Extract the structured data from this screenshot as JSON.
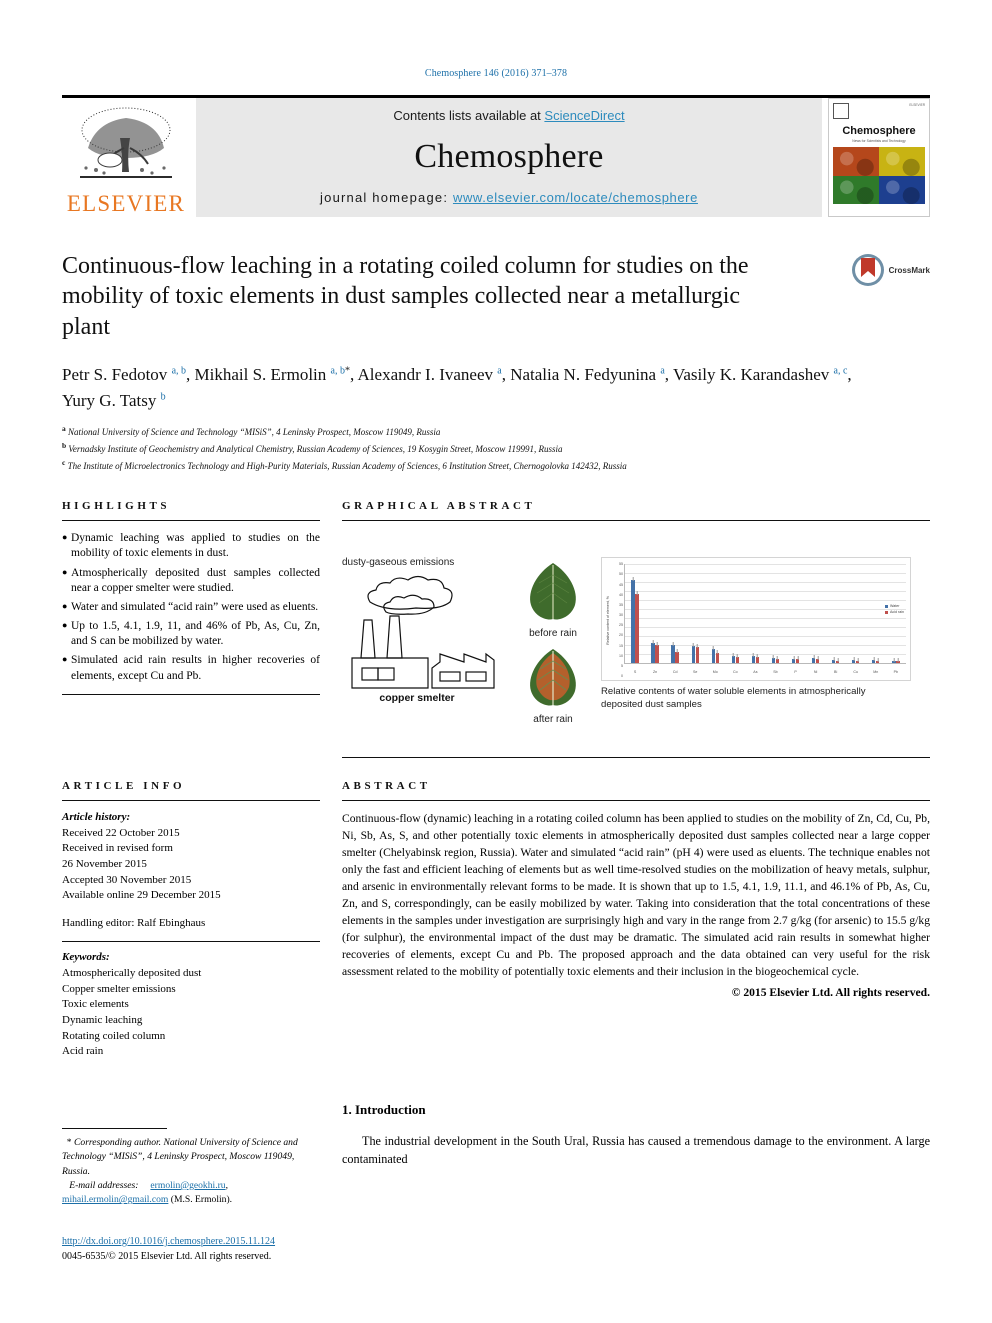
{
  "running_head": "Chemosphere 146 (2016) 371–378",
  "masthead": {
    "contents_prefix": "Contents lists available at ",
    "sciencedirect": "ScienceDirect",
    "journal_name": "Chemosphere",
    "homepage_prefix": "journal homepage: ",
    "homepage_url": "www.elsevier.com/locate/chemosphere",
    "publisher_logo_label": "ELSEVIER",
    "cover": {
      "title": "Chemosphere",
      "subtitle": "News for Scientists and Technology",
      "corner_label": "ELSEVIER"
    }
  },
  "article": {
    "title": "Continuous-flow leaching in a rotating coiled column for studies on the mobility of toxic elements in dust samples collected near a metallurgic plant",
    "crossmark_label": "CrossMark",
    "authors_html": "Petr S. Fedotov <sup>a, b</sup>, Mikhail S. Ermolin <sup>a, b</sup><sup class=\"star\">*</sup>, Alexandr I. Ivaneev <sup>a</sup>, Natalia N. Fedyunina <sup>a</sup>, Vasily K. Karandashev <sup>a, c</sup>, Yury G. Tatsy <sup>b</sup>",
    "affiliations": [
      {
        "marker": "a",
        "text": "National University of Science and Technology “MISiS”, 4 Leninsky Prospect, Moscow 119049, Russia"
      },
      {
        "marker": "b",
        "text": "Vernadsky Institute of Geochemistry and Analytical Chemistry, Russian Academy of Sciences, 19 Kosygin Street, Moscow 119991, Russia"
      },
      {
        "marker": "c",
        "text": "The Institute of Microelectronics Technology and High-Purity Materials, Russian Academy of Sciences, 6 Institution Street, Chernogolovka 142432, Russia"
      }
    ]
  },
  "highlights": {
    "heading": "HIGHLIGHTS",
    "bullet_glyph": "●",
    "items": [
      "Dynamic leaching was applied to studies on the mobility of toxic elements in dust.",
      "Atmospherically deposited dust samples collected near a copper smelter were studied.",
      "Water and simulated “acid rain” were used as eluents.",
      "Up to 1.5, 4.1, 1.9, 11, and 46% of Pb, As, Cu, Zn, and S can be mobilized by water.",
      "Simulated acid rain results in higher recoveries of elements, except Cu and Pb."
    ]
  },
  "graphical_abstract": {
    "heading": "GRAPHICAL ABSTRACT",
    "emissions_label": "dusty-gaseous emissions",
    "smelter_label": "copper smelter",
    "leaf_before_label": "before rain",
    "leaf_after_label": "after rain",
    "chart_caption": "Relative contents of water soluble elements in atmospherically deposited dust samples"
  },
  "chart_data": {
    "type": "bar",
    "title": "",
    "caption": "Relative contents of water soluble elements in atmospherically deposited dust samples",
    "xlabel": "",
    "ylabel": "Relative content of element, %",
    "categories": [
      "S",
      "Zn",
      "Cd",
      "Se",
      "Mo",
      "Co",
      "As",
      "Sb",
      "P",
      "Ni",
      "Bi",
      "Cu",
      "Mn",
      "Pb"
    ],
    "ylim": [
      0,
      55
    ],
    "yticks": [
      0,
      5,
      10,
      15,
      20,
      25,
      30,
      35,
      40,
      45,
      50,
      55
    ],
    "grid": true,
    "legend_position": "right",
    "series": [
      {
        "name": "Water",
        "color": "#4472a8",
        "values": [
          46.1,
          11.0,
          10.2,
          9.5,
          8.1,
          4.2,
          4.1,
          3.0,
          2.6,
          2.8,
          1.9,
          1.7,
          1.6,
          1.5
        ],
        "errors": [
          3.5,
          0.8,
          0.8,
          0.7,
          0.6,
          0.4,
          0.4,
          0.3,
          0.3,
          0.3,
          0.2,
          0.2,
          0.2,
          0.2
        ]
      },
      {
        "name": "Acid rain",
        "color": "#c0504d",
        "values": [
          38.5,
          10.0,
          6.5,
          9.0,
          5.5,
          3.2,
          3.6,
          2.4,
          2.2,
          2.5,
          1.5,
          1.4,
          1.3,
          1.4
        ],
        "errors": [
          2.5,
          0.7,
          0.6,
          0.7,
          0.5,
          0.3,
          0.3,
          0.3,
          0.2,
          0.3,
          0.2,
          0.2,
          0.2,
          0.2
        ]
      }
    ]
  },
  "article_info": {
    "heading": "ARTICLE INFO",
    "history_label": "Article history:",
    "history_lines": [
      "Received 22 October 2015",
      "Received in revised form",
      "26 November 2015",
      "Accepted 30 November 2015",
      "Available online 29 December 2015"
    ],
    "handling_editor": "Handling editor: Ralf Ebinghaus",
    "keywords_label": "Keywords:",
    "keywords": [
      "Atmospherically deposited dust",
      "Copper smelter emissions",
      "Toxic elements",
      "Dynamic leaching",
      "Rotating coiled column",
      "Acid rain"
    ]
  },
  "abstract": {
    "heading": "ABSTRACT",
    "text": "Continuous-flow (dynamic) leaching in a rotating coiled column has been applied to studies on the mobility of Zn, Cd, Cu, Pb, Ni, Sb, As, S, and other potentially toxic elements in atmospherically deposited dust samples collected near a large copper smelter (Chelyabinsk region, Russia). Water and simulated “acid rain” (pH 4) were used as eluents. The technique enables not only the fast and efficient leaching of elements but as well time-resolved studies on the mobilization of heavy metals, sulphur, and arsenic in environmentally relevant forms to be made. It is shown that up to 1.5, 4.1, 1.9, 11.1, and 46.1% of Pb, As, Cu, Zn, and S, correspondingly, can be easily mobilized by water. Taking into consideration that the total concentrations of these elements in the samples under investigation are surprisingly high and vary in the range from 2.7 g/kg (for arsenic) to 15.5 g/kg (for sulphur), the environmental impact of the dust may be dramatic. The simulated acid rain results in somewhat higher recoveries of elements, except Cu and Pb. The proposed approach and the data obtained can very useful for the risk assessment related to the mobility of potentially toxic elements and their inclusion in the biogeochemical cycle.",
    "copyright": "© 2015 Elsevier Ltd. All rights reserved."
  },
  "footnote": {
    "star": "*",
    "corresponding": "Corresponding author. National University of Science and Technology “MISiS”, 4 Leninsky Prospect, Moscow 119049, Russia.",
    "email_label": "E-mail addresses:",
    "email1": "ermolin@geokhi.ru",
    "email2": "mihail.ermolin@gmail.com",
    "email_owner": "(M.S. Ermolin)."
  },
  "doi_block": {
    "doi": "http://dx.doi.org/10.1016/j.chemosphere.2015.11.124",
    "issn_line": "0045-6535/© 2015 Elsevier Ltd. All rights reserved."
  },
  "introduction": {
    "heading": "1. Introduction",
    "paragraph": "The industrial development in the South Ural, Russia has caused a tremendous damage to the environment. A large contaminated"
  }
}
